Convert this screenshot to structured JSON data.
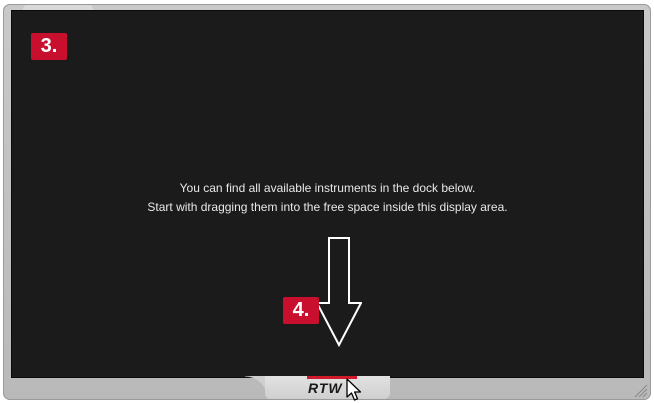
{
  "badges": {
    "step3": "3.",
    "step4": "4."
  },
  "message": {
    "line1": "You can find all available instruments in the dock below.",
    "line2": "Start with dragging them into the free space inside this display area."
  },
  "dock": {
    "logo_text": "RTW"
  },
  "icons": {
    "arrow": "down-arrow-icon",
    "cursor": "mouse-pointer-icon",
    "grip": "resize-grip-icon"
  },
  "colors": {
    "accent": "#c8102e",
    "display_bg": "#1b1b1b",
    "frame_bg": "#c4c4c4"
  }
}
